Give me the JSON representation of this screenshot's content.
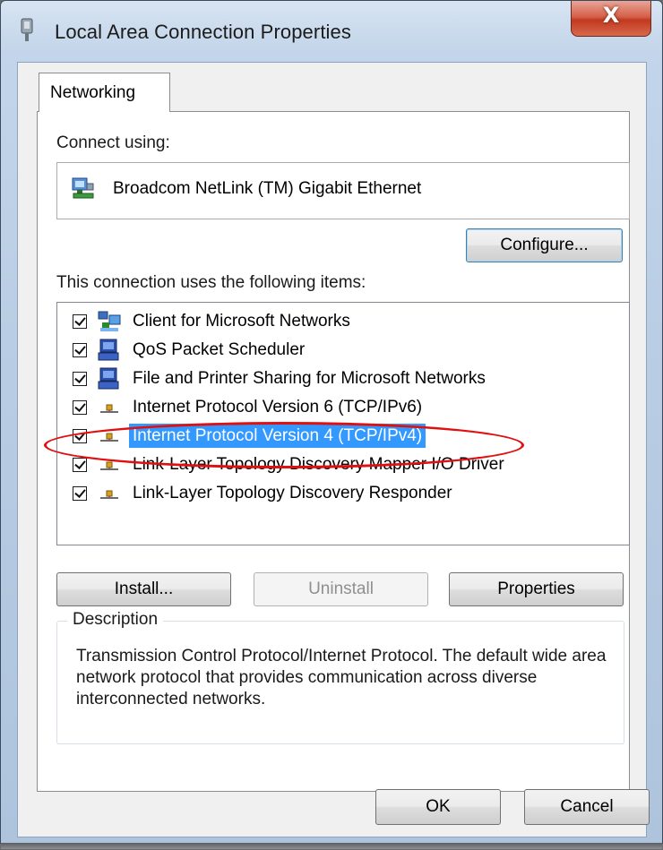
{
  "window": {
    "title": "Local Area Connection Properties",
    "close_glyph": "X"
  },
  "tab": {
    "label": "Networking"
  },
  "connect_using": {
    "label": "Connect using:",
    "adapter": "Broadcom NetLink (TM) Gigabit Ethernet",
    "configure_button": "Configure..."
  },
  "items": {
    "label": "This connection uses the following items:",
    "list": [
      {
        "label": "Client for Microsoft Networks",
        "checked": true,
        "icon": "network-client-icon",
        "selected": false
      },
      {
        "label": "QoS Packet Scheduler",
        "checked": true,
        "icon": "computer-service-icon",
        "selected": false
      },
      {
        "label": "File and Printer Sharing for Microsoft Networks",
        "checked": true,
        "icon": "computer-service-icon",
        "selected": false
      },
      {
        "label": "Internet Protocol Version 6 (TCP/IPv6)",
        "checked": true,
        "icon": "protocol-icon",
        "selected": false
      },
      {
        "label": "Internet Protocol Version 4 (TCP/IPv4)",
        "checked": true,
        "icon": "protocol-icon",
        "selected": true
      },
      {
        "label": "Link-Layer Topology Discovery Mapper I/O Driver",
        "checked": true,
        "icon": "protocol-icon",
        "selected": false
      },
      {
        "label": "Link-Layer Topology Discovery Responder",
        "checked": true,
        "icon": "protocol-icon",
        "selected": false
      }
    ]
  },
  "buttons": {
    "install": "Install...",
    "uninstall": "Uninstall",
    "properties": "Properties",
    "ok": "OK",
    "cancel": "Cancel"
  },
  "description": {
    "title": "Description",
    "text": "Transmission Control Protocol/Internet Protocol. The default wide area network protocol that provides communication across diverse interconnected networks."
  },
  "colors": {
    "selection": "#3399ff",
    "annotation": "#e11010",
    "close_button": "#c2391f"
  }
}
